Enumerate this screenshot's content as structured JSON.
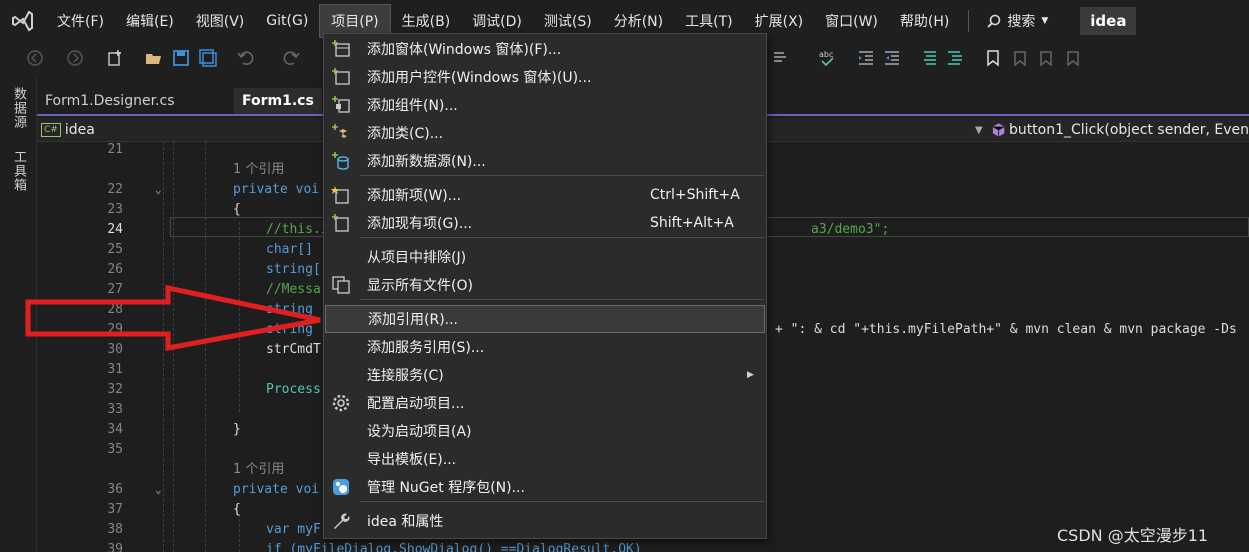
{
  "menubar": {
    "items": [
      "文件(F)",
      "编辑(E)",
      "视图(V)",
      "Git(G)",
      "项目(P)",
      "生成(B)",
      "调试(D)",
      "测试(S)",
      "分析(N)",
      "工具(T)",
      "扩展(X)",
      "窗口(W)",
      "帮助(H)"
    ],
    "active_item": "项目(P)",
    "search_label": "搜索",
    "solution_name": "idea"
  },
  "side_tools": [
    "数据源",
    "工具箱"
  ],
  "tabs": [
    {
      "label": "Form1.Designer.cs",
      "active": false
    },
    {
      "label": "Form1.cs",
      "active": true
    }
  ],
  "navbar": {
    "project": "idea",
    "project_badge": "C#",
    "member": "button1_Click(object sender, Even"
  },
  "editor": {
    "current_line": "24",
    "lines": [
      {
        "num": "21",
        "code": ""
      },
      {
        "num": "",
        "code": "1 个引用"
      },
      {
        "num": "22",
        "code": "private voi"
      },
      {
        "num": "23",
        "code": "{"
      },
      {
        "num": "24",
        "code": "//this.i",
        "tail": "a3/demo3\";"
      },
      {
        "num": "25",
        "code": "char[]"
      },
      {
        "num": "26",
        "code": "string["
      },
      {
        "num": "27",
        "code": "//Messa"
      },
      {
        "num": "28",
        "code": "string"
      },
      {
        "num": "29",
        "code": "string",
        "tail": "+ \": & cd \"+this.myFilePath+\" & mvn clean & mvn package -Ds"
      },
      {
        "num": "30",
        "code": "strCmdT"
      },
      {
        "num": "31",
        "code": ""
      },
      {
        "num": "32",
        "code": "Process"
      },
      {
        "num": "33",
        "code": ""
      },
      {
        "num": "34",
        "code": "}"
      },
      {
        "num": "35",
        "code": ""
      },
      {
        "num": "",
        "code": "1 个引用"
      },
      {
        "num": "36",
        "code": "private voi"
      },
      {
        "num": "37",
        "code": "{"
      },
      {
        "num": "38",
        "code": "var myF"
      },
      {
        "num": "39",
        "code": "if (myFileDialog.ShowDialog() ==DialogResult.OK)"
      }
    ]
  },
  "project_menu": {
    "items": [
      {
        "label": "添加窗体(Windows 窗体)(F)...",
        "icon": "add-form-icon"
      },
      {
        "label": "添加用户控件(Windows 窗体)(U)...",
        "icon": "add-usercontrol-icon"
      },
      {
        "label": "添加组件(N)...",
        "icon": "add-component-icon"
      },
      {
        "label": "添加类(C)...",
        "icon": "add-class-icon"
      },
      {
        "label": "添加新数据源(N)...",
        "icon": "add-datasource-icon"
      },
      {
        "label": "添加新项(W)...",
        "icon": "add-new-item-icon",
        "shortcut": "Ctrl+Shift+A"
      },
      {
        "label": "添加现有项(G)...",
        "icon": "add-existing-item-icon",
        "shortcut": "Shift+Alt+A"
      },
      {
        "label": "从项目中排除(J)",
        "icon": ""
      },
      {
        "label": "显示所有文件(O)",
        "icon": "show-all-files-icon"
      },
      {
        "label": "添加引用(R)...",
        "icon": "",
        "highlighted": true
      },
      {
        "label": "添加服务引用(S)...",
        "icon": ""
      },
      {
        "label": "连接服务(C)",
        "icon": "",
        "submenu": true
      },
      {
        "label": "配置启动项目...",
        "icon": "gear-icon"
      },
      {
        "label": "设为启动项目(A)",
        "icon": ""
      },
      {
        "label": "导出模板(E)...",
        "icon": ""
      },
      {
        "label": "管理 NuGet 程序包(N)...",
        "icon": "nuget-icon"
      },
      {
        "label": "idea 和属性",
        "icon": "wrench-icon"
      }
    ]
  },
  "colors": {
    "accent": "#6d5ec6",
    "arrow": "#e02020",
    "menu_bg": "#2b2b2b"
  },
  "watermark": "CSDN @太空漫步11"
}
